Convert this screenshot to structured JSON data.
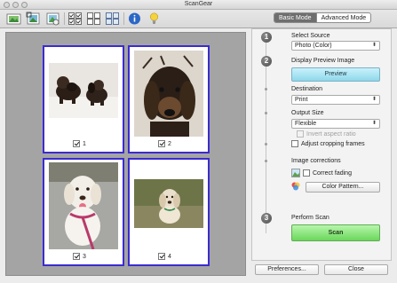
{
  "window": {
    "title": "ScanGear"
  },
  "toolbar": {
    "buttons": [
      {
        "icon": "scan-to-image-icon"
      },
      {
        "icon": "crop-image-icon"
      },
      {
        "icon": "auto-crop-icon"
      },
      {
        "icon": "select-all-frames-icon"
      },
      {
        "icon": "deselect-frames-icon"
      },
      {
        "icon": "thumbnail-view-icon"
      },
      {
        "icon": "info-icon"
      },
      {
        "icon": "help-bulb-icon"
      }
    ]
  },
  "preview": {
    "thumbnails": [
      {
        "number": "1",
        "checked": true
      },
      {
        "number": "2",
        "checked": true
      },
      {
        "number": "3",
        "checked": true
      },
      {
        "number": "4",
        "checked": true
      }
    ]
  },
  "tabs": {
    "basic": "Basic Mode",
    "advanced": "Advanced Mode",
    "active": "basic"
  },
  "steps": {
    "one": "1",
    "two": "2",
    "three": "3"
  },
  "select_source": {
    "label": "Select Source",
    "value": "Photo (Color)"
  },
  "display_preview": {
    "label": "Display Preview Image",
    "button": "Preview"
  },
  "destination": {
    "label": "Destination",
    "value": "Print"
  },
  "output_size": {
    "label": "Output Size",
    "value": "Flexible",
    "invert_label": "Invert aspect ratio",
    "invert_checked": false
  },
  "adjust_frames": {
    "label": "Adjust cropping frames",
    "checked": false
  },
  "image_corrections": {
    "label": "Image corrections",
    "correct_fading": "Correct fading",
    "correct_fading_checked": false,
    "color_pattern_button": "Color Pattern..."
  },
  "perform_scan": {
    "label": "Perform Scan",
    "button": "Scan"
  },
  "footer": {
    "preferences": "Preferences...",
    "close": "Close"
  },
  "colors": {
    "frame_border": "#3b2bd1",
    "preview_bg": "#a4a4a4",
    "scan_button": "#6ad75b",
    "preview_button": "#8fd8ea"
  }
}
